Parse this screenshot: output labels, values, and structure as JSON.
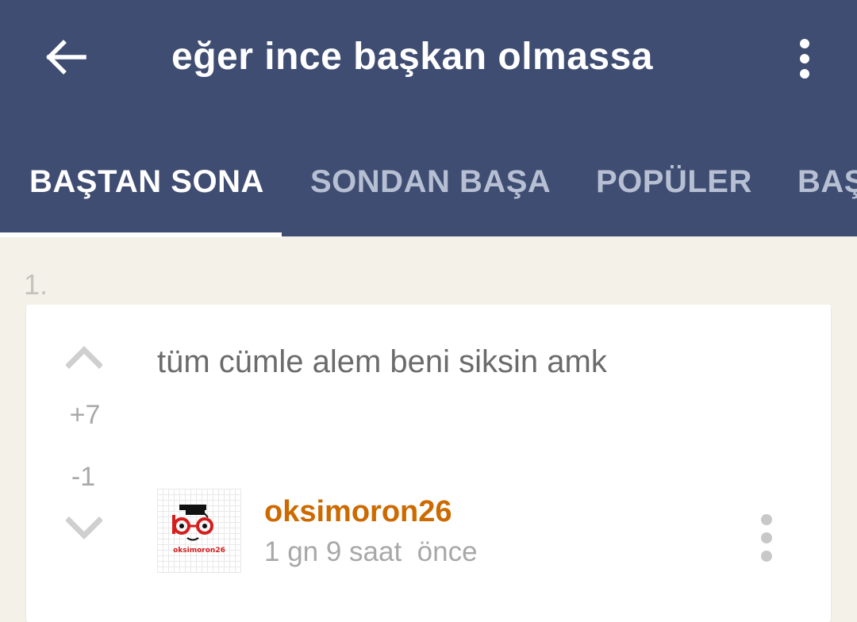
{
  "appbar": {
    "title": "eğer ince başkan olmassa",
    "back_icon": "arrow-left-icon",
    "more_icon": "more-vertical-icon",
    "background_color": "#3f4d72"
  },
  "tabs": [
    {
      "label": "BAŞTAN SONA",
      "active": true
    },
    {
      "label": "SONDAN BAŞA",
      "active": false
    },
    {
      "label": "POPÜLER",
      "active": false
    },
    {
      "label": "BAŞ",
      "active": false
    }
  ],
  "entry": {
    "number": "1.",
    "text": "tüm cümle alem beni siksin amk",
    "upvotes": "+7",
    "downvotes": "-1",
    "author": "oksimoron26",
    "avatar_caption": "oksimoron26",
    "time": "1 gn 9 saat  önce",
    "author_color": "#cc6a00"
  }
}
